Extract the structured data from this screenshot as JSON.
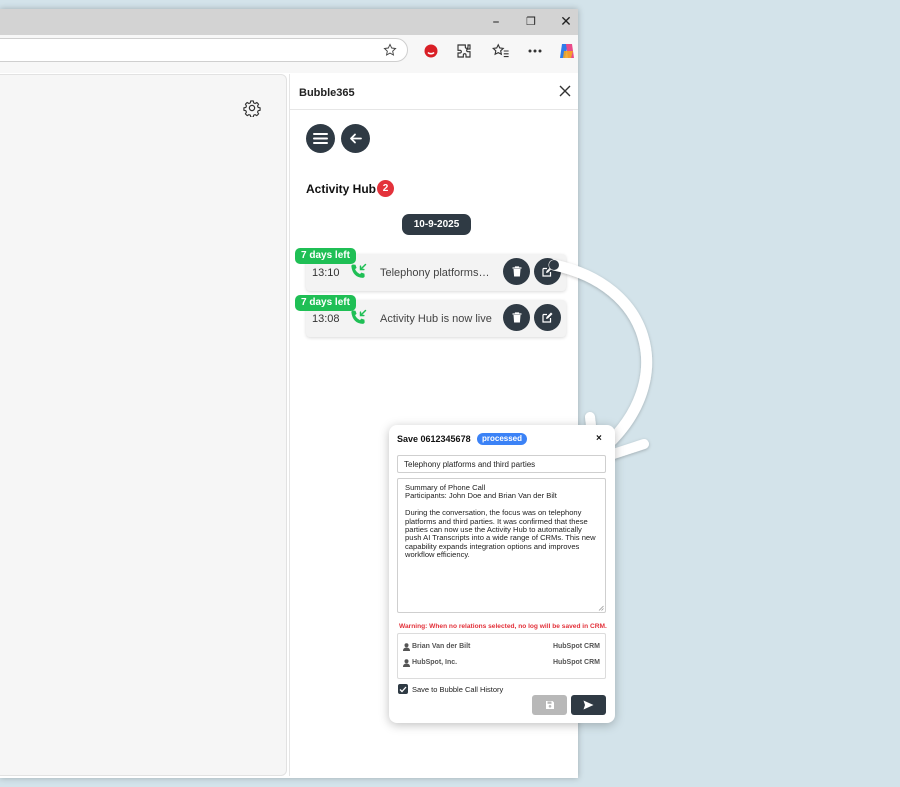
{
  "browser": {
    "icons": [
      "star-icon",
      "record-icon",
      "extensions-icon",
      "favorites-icon",
      "more-icon",
      "copilot-icon"
    ]
  },
  "panel": {
    "title": "Bubble365",
    "hub_title": "Activity Hub",
    "hub_count": "2",
    "date": "10-9-2025",
    "activities": [
      {
        "time": "13:10",
        "text": "Telephony platforms and third parties",
        "days_left": "7 days left"
      },
      {
        "time": "13:08",
        "text": "Activity Hub is now live",
        "days_left": "7 days left"
      }
    ]
  },
  "modal": {
    "title": "Save 0612345678",
    "status": "processed",
    "close": "×",
    "subject": "Telephony platforms and third parties",
    "body": "Summary of Phone Call\nParticipants: John Doe and Brian Van der Bilt\n\nDuring the conversation, the focus was on telephony platforms and third parties. It was confirmed that these parties can now use the Activity Hub to automatically push AI Transcripts into a wide range of CRMs. This new capability expands integration options and improves workflow efficiency.",
    "warning": "Warning: When no relations selected, no log will be saved in CRM.",
    "relations": [
      {
        "name": "Brian Van der Bilt",
        "crm": "HubSpot CRM"
      },
      {
        "name": "HubSpot, Inc.",
        "crm": "HubSpot CRM"
      }
    ],
    "save_history_label": "Save to Bubble Call History",
    "save_history_checked": true
  },
  "colors": {
    "dark": "#2f3a44",
    "green": "#1fbf55",
    "red": "#e3323b",
    "blue": "#3b82f6"
  }
}
